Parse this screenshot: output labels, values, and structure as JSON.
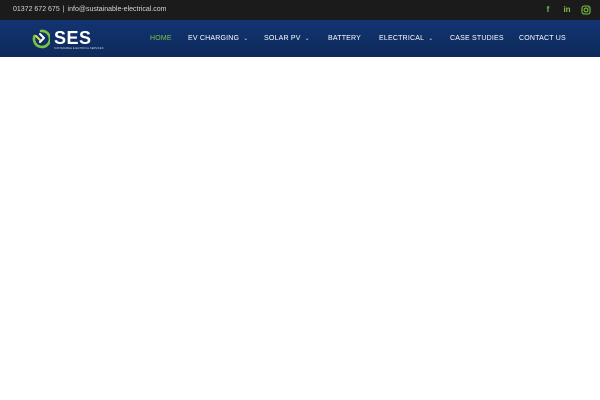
{
  "topbar": {
    "phone": "01372 672 675",
    "separator": "|",
    "email": "info@sustainable-electrical.com",
    "social": [
      {
        "icon": "facebook-icon",
        "glyph": "f"
      },
      {
        "icon": "linkedin-icon",
        "glyph": "in"
      },
      {
        "icon": "instagram-icon",
        "glyph": ""
      }
    ]
  },
  "header": {
    "logo_text": "SES",
    "logo_tagline": "SUSTAINABLE ELECTRICAL SERVICES",
    "menu": [
      {
        "label": "HOME",
        "active": true
      },
      {
        "label": "EV CHARGING",
        "dropdown": true
      },
      {
        "label": "SOLAR PV",
        "dropdown": true
      },
      {
        "label": "BATTERY"
      },
      {
        "label": "ELECTRICAL",
        "dropdown": true
      },
      {
        "label": "CASE STUDIES"
      },
      {
        "label": "CONTACT US"
      }
    ]
  },
  "colors": {
    "topbar_bg": "#1b1b1b",
    "nav_bg": "#0f2e63",
    "accent": "#7cc242",
    "text_light": "#ffffff"
  }
}
